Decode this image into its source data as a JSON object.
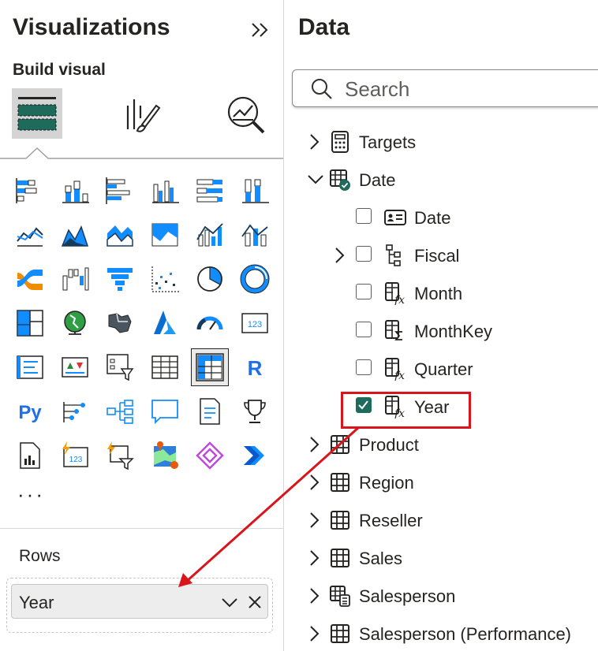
{
  "viz": {
    "title": "Visualizations",
    "build_visual": "Build visual",
    "more": "···",
    "rows_label": "Rows",
    "rows_field": "Year"
  },
  "data_pane": {
    "title": "Data",
    "search_placeholder": "Search",
    "tables": {
      "targets": "Targets",
      "date": "Date",
      "product": "Product",
      "region": "Region",
      "reseller": "Reseller",
      "sales": "Sales",
      "salesperson": "Salesperson",
      "salesperson_perf": "Salesperson (Performance)"
    },
    "date_fields": {
      "date": "Date",
      "fiscal": "Fiscal",
      "month": "Month",
      "monthkey": "MonthKey",
      "quarter": "Quarter",
      "year": "Year"
    },
    "checked": [
      "Year"
    ]
  },
  "icons": {
    "visual_types": [
      "stacked-bar",
      "stacked-column",
      "clustered-bar",
      "clustered-column",
      "100-stacked-bar",
      "100-stacked-column",
      "line",
      "area",
      "stacked-area",
      "100-stacked-area",
      "line-clustered-column",
      "line-stacked-column",
      "ribbon",
      "waterfall",
      "funnel",
      "scatter",
      "pie",
      "donut",
      "treemap",
      "map",
      "filled-map",
      "azure-map",
      "gauge",
      "card",
      "multi-row-card",
      "kpi",
      "slicer",
      "table",
      "matrix",
      "r-visual",
      "python-visual",
      "key-influencers",
      "decomposition-tree",
      "qa",
      "smart-narrative",
      "metrics",
      "paginated-report",
      "power-apps-card",
      "power-automate-slicer",
      "arcgis-map",
      "power-apps",
      "power-automate"
    ]
  },
  "colors": {
    "accent_blue": "#118dff",
    "dark_navy": "#1a3a5c",
    "teal_check": "#1e6b5c",
    "highlight_red": "#d9141a",
    "active_tab_bg": "#d4d4d4"
  }
}
